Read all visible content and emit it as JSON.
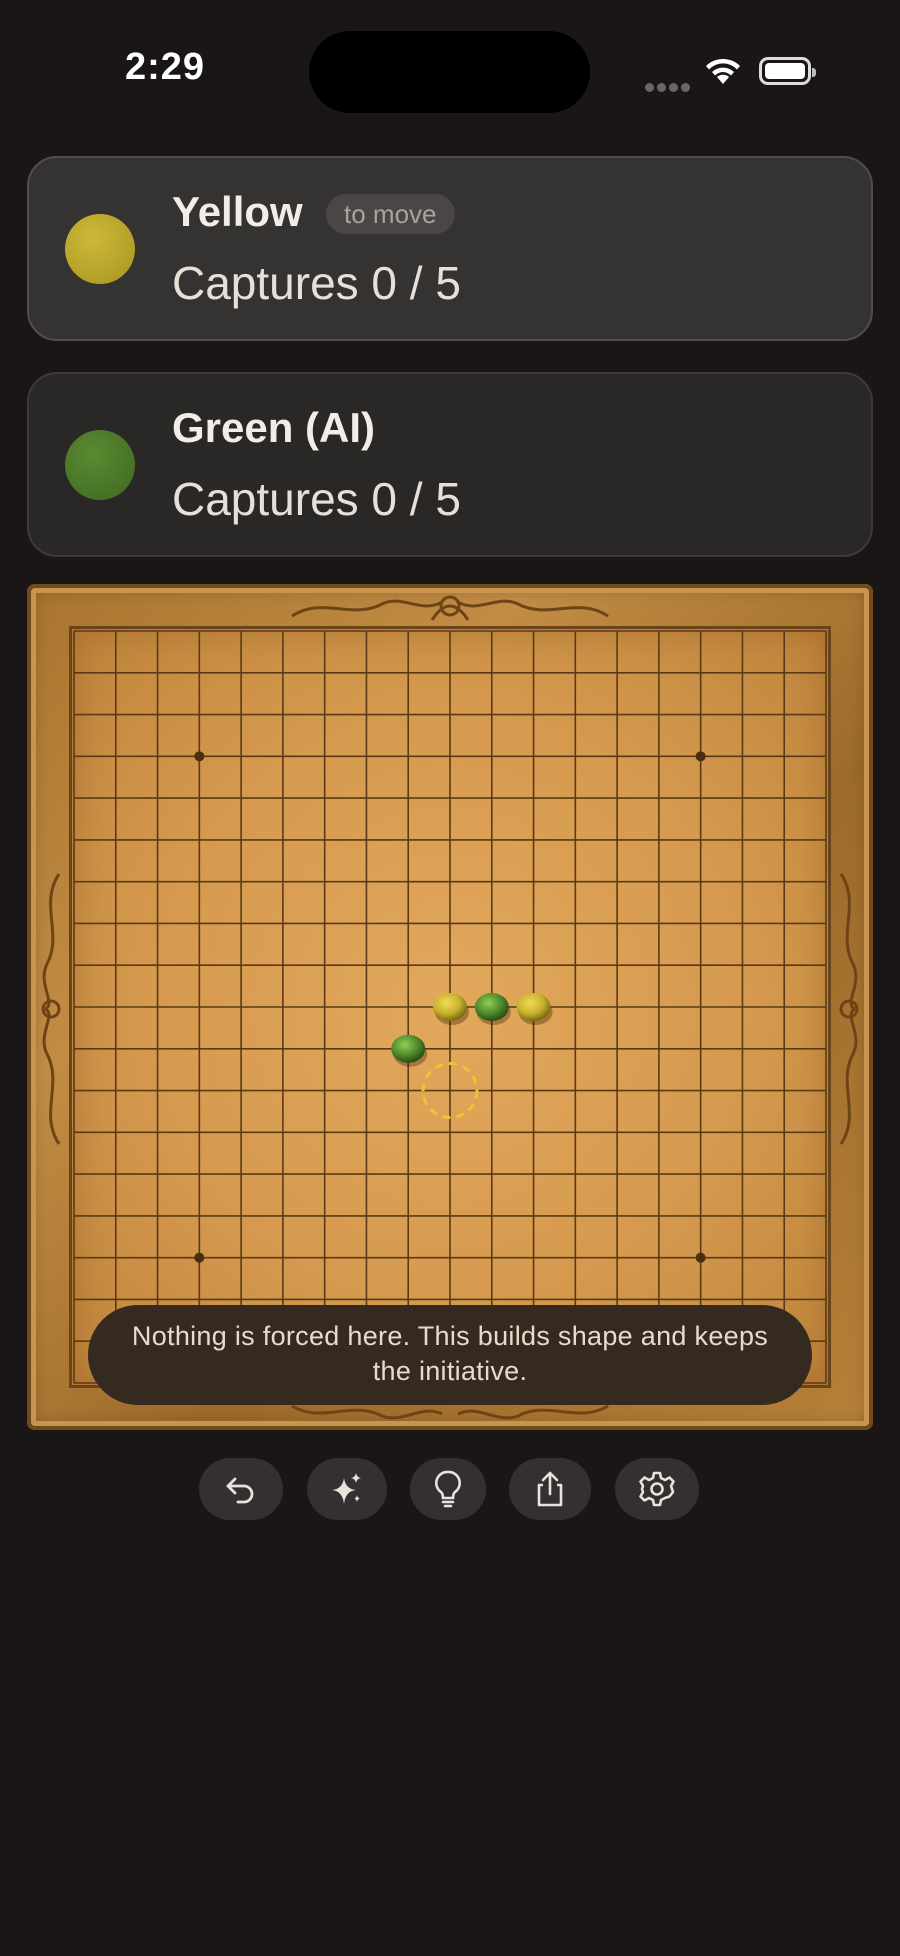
{
  "status_bar": {
    "time": "2:29"
  },
  "players": [
    {
      "name": "Yellow",
      "badge": "to move",
      "captures": "Captures 0 / 5",
      "color": "#b9a52c",
      "active": true
    },
    {
      "name": "Green (AI)",
      "badge": "",
      "captures": "Captures 0 / 5",
      "color": "#4f7a2a",
      "active": false
    }
  ],
  "board": {
    "size": 19,
    "star_points": [
      [
        3,
        3
      ],
      [
        3,
        15
      ],
      [
        15,
        3
      ],
      [
        15,
        15
      ]
    ],
    "stones": [
      {
        "color": "yellow",
        "col": 9,
        "row": 9
      },
      {
        "color": "green",
        "col": 10,
        "row": 9
      },
      {
        "color": "yellow",
        "col": 11,
        "row": 9
      },
      {
        "color": "green",
        "col": 8,
        "row": 10
      }
    ],
    "hint_marker": {
      "col": 9,
      "row": 11
    }
  },
  "tooltip": {
    "text": "Nothing is forced here. This builds shape and keeps the initiative."
  },
  "toolbar": {
    "buttons": [
      "undo-icon",
      "sparkles-icon",
      "lightbulb-icon",
      "share-icon",
      "gear-icon"
    ]
  },
  "colors": {
    "yellow_stone": "#c7b12e",
    "green_stone": "#4d8a2c",
    "hint": "#f1c232"
  }
}
